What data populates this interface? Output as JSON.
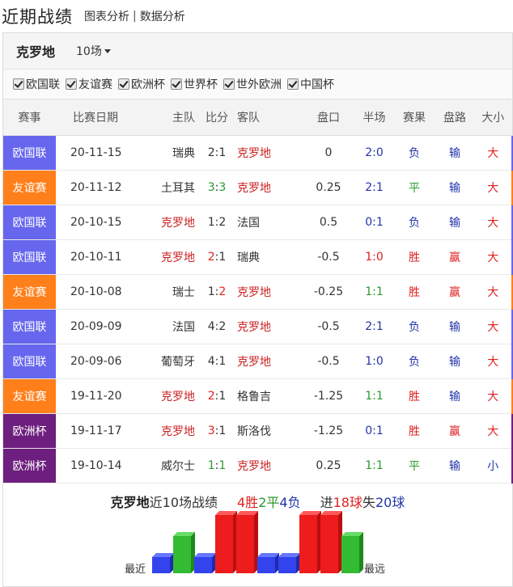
{
  "header": {
    "title": "近期战绩",
    "nav": [
      "图表分析",
      "数据分析"
    ],
    "separator": "|"
  },
  "team": {
    "name": "克罗地",
    "match_count": "10场"
  },
  "filters": [
    "欧国联",
    "友谊赛",
    "欧洲杯",
    "世界杯",
    "世外欧洲",
    "中国杯"
  ],
  "columns": [
    "赛事",
    "比赛日期",
    "主队",
    "比分",
    "客队",
    "盘口",
    "半场",
    "赛果",
    "盘路",
    "大小"
  ],
  "league_colors": {
    "欧国联": "#6666ee",
    "友谊赛": "#ff7f1a",
    "欧洲杯": "#6e1e7e"
  },
  "colors": {
    "win": "#e02020",
    "draw": "#2a9a2a",
    "loss": "#2233aa",
    "team": "#cc2222"
  },
  "matches": [
    {
      "league": "欧国联",
      "date": "20-11-15",
      "home": "瑞典",
      "score_h": "2",
      "score_a": "1",
      "away": "克罗地",
      "line": "0",
      "half": "2:0",
      "half_win": "loss",
      "result": "负",
      "result_c": "loss",
      "pan": "输",
      "pan_c": "loss",
      "ou": "大",
      "ou_c": "win"
    },
    {
      "league": "友谊赛",
      "date": "20-11-12",
      "home": "土耳其",
      "score_h": "3",
      "score_a": "3",
      "away": "克罗地",
      "line": "0.25",
      "half": "2:1",
      "half_win": "loss",
      "result": "平",
      "result_c": "draw",
      "pan": "输",
      "pan_c": "loss",
      "ou": "大",
      "ou_c": "win"
    },
    {
      "league": "欧国联",
      "date": "20-10-15",
      "home": "克罗地",
      "score_h": "1",
      "score_a": "2",
      "away": "法国",
      "line": "0.5",
      "half": "0:1",
      "half_win": "loss",
      "result": "负",
      "result_c": "loss",
      "pan": "输",
      "pan_c": "loss",
      "ou": "大",
      "ou_c": "win"
    },
    {
      "league": "欧国联",
      "date": "20-10-11",
      "home": "克罗地",
      "score_h": "2",
      "score_a": "1",
      "away": "瑞典",
      "line": "-0.5",
      "half": "1:0",
      "half_win": "win",
      "result": "胜",
      "result_c": "win",
      "pan": "赢",
      "pan_c": "win",
      "ou": "大",
      "ou_c": "win"
    },
    {
      "league": "友谊赛",
      "date": "20-10-08",
      "home": "瑞士",
      "score_h": "1",
      "score_a": "2",
      "away": "克罗地",
      "line": "-0.25",
      "half": "1:1",
      "half_win": "draw",
      "result": "胜",
      "result_c": "win",
      "pan": "赢",
      "pan_c": "win",
      "ou": "大",
      "ou_c": "win"
    },
    {
      "league": "欧国联",
      "date": "20-09-09",
      "home": "法国",
      "score_h": "4",
      "score_a": "2",
      "away": "克罗地",
      "line": "-0.5",
      "half": "2:1",
      "half_win": "loss",
      "result": "负",
      "result_c": "loss",
      "pan": "输",
      "pan_c": "loss",
      "ou": "大",
      "ou_c": "win"
    },
    {
      "league": "欧国联",
      "date": "20-09-06",
      "home": "葡萄牙",
      "score_h": "4",
      "score_a": "1",
      "away": "克罗地",
      "line": "-0.5",
      "half": "1:0",
      "half_win": "loss",
      "result": "负",
      "result_c": "loss",
      "pan": "输",
      "pan_c": "loss",
      "ou": "大",
      "ou_c": "win"
    },
    {
      "league": "友谊赛",
      "date": "19-11-20",
      "home": "克罗地",
      "score_h": "2",
      "score_a": "1",
      "away": "格鲁吉",
      "line": "-1.25",
      "half": "1:1",
      "half_win": "draw",
      "result": "胜",
      "result_c": "win",
      "pan": "输",
      "pan_c": "loss",
      "ou": "大",
      "ou_c": "win"
    },
    {
      "league": "欧洲杯",
      "date": "19-11-17",
      "home": "克罗地",
      "score_h": "3",
      "score_a": "1",
      "away": "斯洛伐",
      "line": "-1.25",
      "half": "0:1",
      "half_win": "loss",
      "result": "胜",
      "result_c": "win",
      "pan": "赢",
      "pan_c": "win",
      "ou": "大",
      "ou_c": "win"
    },
    {
      "league": "欧洲杯",
      "date": "19-10-14",
      "home": "威尔士",
      "score_h": "1",
      "score_a": "1",
      "away": "克罗地",
      "line": "0.25",
      "half": "1:1",
      "half_win": "draw",
      "result": "平",
      "result_c": "draw",
      "pan": "输",
      "pan_c": "loss",
      "ou": "小",
      "ou_c": "loss"
    }
  ],
  "summary": {
    "team": "克罗地",
    "text": "近10场战绩",
    "wins": "4胜",
    "draws": "2平",
    "losses": "4负",
    "goals_pre": "进",
    "goals_for": "18球",
    "goals_mid": "失",
    "goals_against": "20球"
  },
  "chart": {
    "left_label": "最近",
    "right_label": "最远",
    "results": [
      "loss",
      "draw",
      "loss",
      "win",
      "win",
      "loss",
      "loss",
      "win",
      "win",
      "draw"
    ]
  }
}
